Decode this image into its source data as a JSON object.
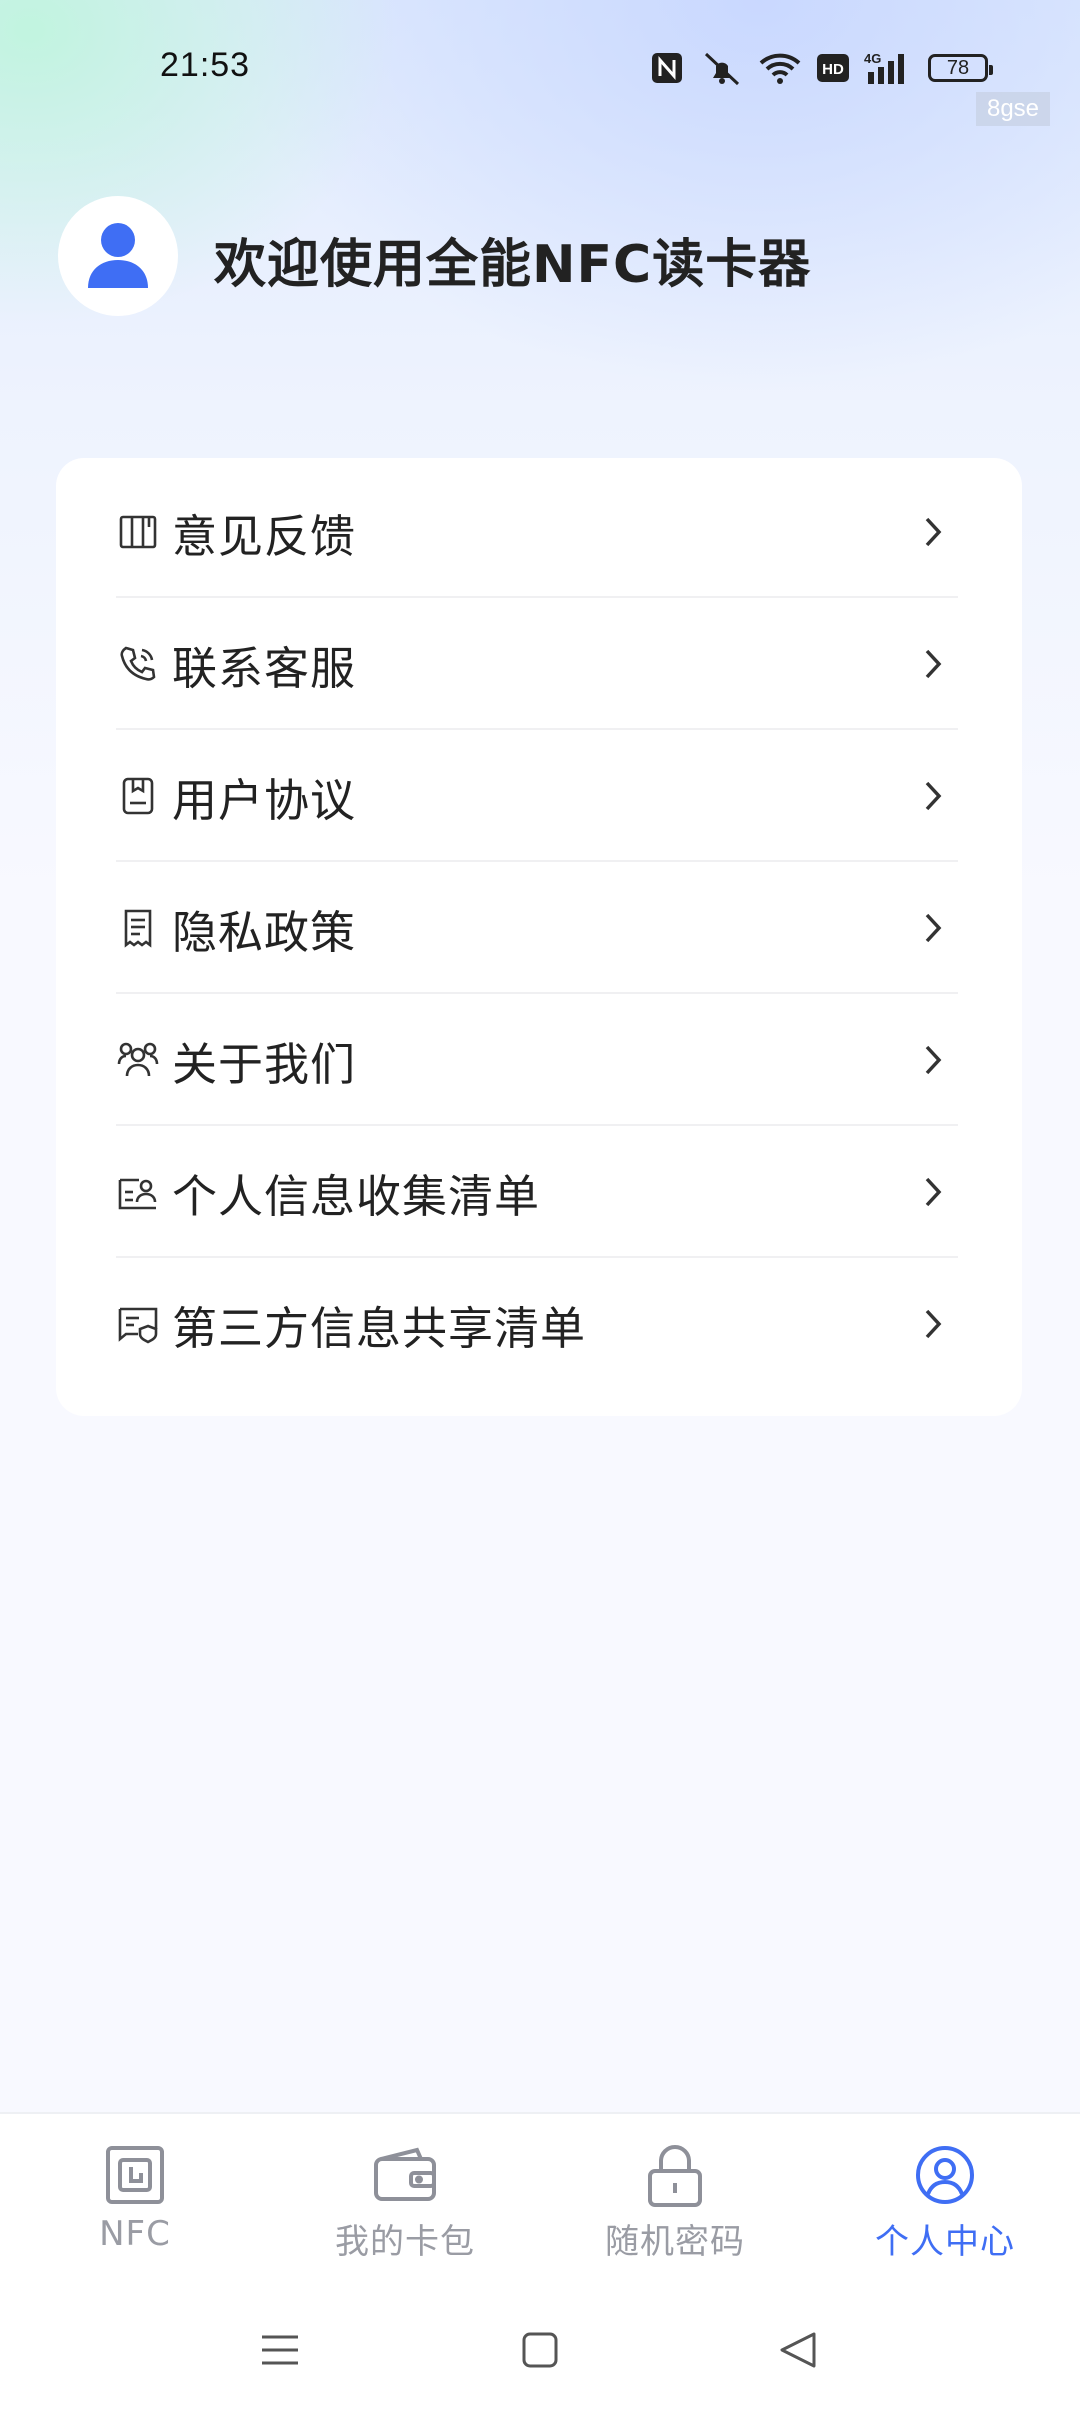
{
  "status_bar": {
    "time": "21:53",
    "battery_level": "78",
    "icons": [
      "nfc-icon",
      "bell-muted-icon",
      "wifi-icon",
      "hd-icon",
      "signal-4g-icon",
      "battery-icon"
    ],
    "watermark": "8gse"
  },
  "header": {
    "welcome_text": "欢迎使用全能NFC读卡器",
    "avatar_icon": "user-avatar-icon"
  },
  "menu": {
    "items": [
      {
        "label": "意见反馈",
        "icon": "feedback-icon"
      },
      {
        "label": "联系客服",
        "icon": "phone-icon"
      },
      {
        "label": "用户协议",
        "icon": "agreement-icon"
      },
      {
        "label": "隐私政策",
        "icon": "privacy-icon"
      },
      {
        "label": "关于我们",
        "icon": "team-icon"
      },
      {
        "label": "个人信息收集清单",
        "icon": "personal-info-icon"
      },
      {
        "label": "第三方信息共享清单",
        "icon": "share-info-icon"
      }
    ]
  },
  "tabbar": {
    "tabs": [
      {
        "label": "NFC",
        "icon": "nfc-tab-icon",
        "active": false
      },
      {
        "label": "我的卡包",
        "icon": "wallet-icon",
        "active": false
      },
      {
        "label": "随机密码",
        "icon": "lock-icon",
        "active": false
      },
      {
        "label": "个人中心",
        "icon": "profile-icon",
        "active": true
      }
    ]
  },
  "colors": {
    "accent": "#3f6ef4",
    "text": "#222222",
    "inactive": "#9a9ca4"
  }
}
